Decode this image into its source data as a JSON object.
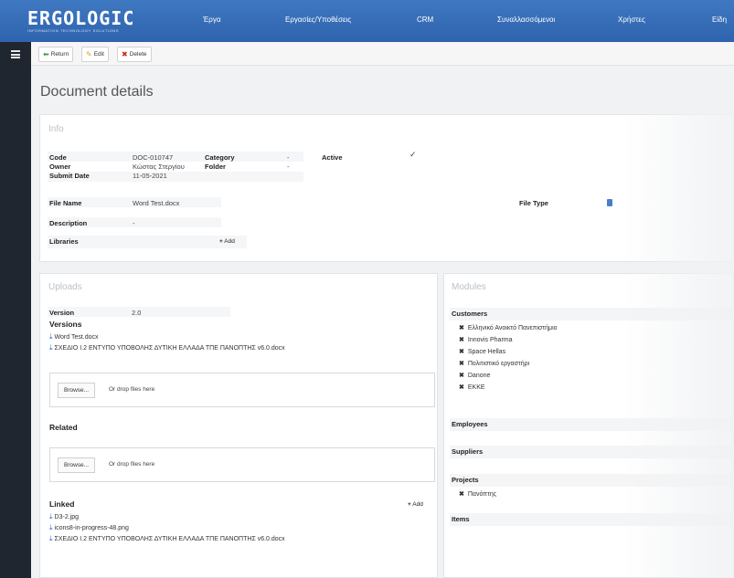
{
  "app": {
    "logo": "ERGOLOGIC",
    "logo_sub": "INFORMATION TECHNOLOGY SOLUTIONS",
    "nav": [
      "Έργα",
      "Εργασίες/Υποθέσεις",
      "CRM",
      "Συναλλασσόμενοι",
      "Χρήστες",
      "Είδη"
    ]
  },
  "toolbar": {
    "return_label": "Return",
    "edit_label": "Edit",
    "delete_label": "Delete"
  },
  "page_title": "Document details",
  "info": {
    "title": "Info",
    "code_label": "Code",
    "code_value": "DOC-010747",
    "owner_label": "Owner",
    "owner_value": "Κώστας Στεργίου",
    "submit_label": "Submit Date",
    "submit_value": "11-05-2021",
    "category_label": "Category",
    "category_value": "-",
    "folder_label": "Folder",
    "folder_value": "-",
    "active_label": "Active",
    "active_value": "✓",
    "filename_label": "File Name",
    "filename_value": "Word Test.docx",
    "filetype_label": "File Type",
    "description_label": "Description",
    "description_value": "-",
    "libraries_label": "Libraries",
    "add_label": "Add"
  },
  "uploads": {
    "title": "Uploads",
    "version_label": "Version",
    "version_value": "2.0",
    "versions_label": "Versions",
    "versions": [
      "Word Test.docx",
      "ΣΧΕΔΙΟ Ι.2 ΕΝΤΥΠΟ ΥΠΟΒΟΛΗΣ ΔΥΤΙΚΗ ΕΛΛΑΔΑ ΤΠΕ ΠΑΝΟΠΤΗΣ v6.0.docx"
    ],
    "browse_label": "Browse...",
    "drop_hint": "Or drop files here",
    "related_label": "Related",
    "linked_label": "Linked",
    "add_label": "Add",
    "linked": [
      "D3-2.jpg",
      "icons8-in-progress-48.png",
      "ΣΧΕΔΙΟ Ι.2 ΕΝΤΥΠΟ ΥΠΟΒΟΛΗΣ ΔΥΤΙΚΗ ΕΛΛΑΔΑ ΤΠΕ ΠΑΝΟΠΤΗΣ v6.0.docx"
    ]
  },
  "modules": {
    "title": "Modules",
    "customers_label": "Customers",
    "customers": [
      "Ελληνικό Ανοικτό Πανεπιστήμιο",
      "Innovis Pharma",
      "Space Hellas",
      "Πολιτιστικό εργαστήρι",
      "Danone",
      "ΕΚΚΕ"
    ],
    "employees_label": "Employees",
    "suppliers_label": "Suppliers",
    "projects_label": "Projects",
    "projects": [
      "Πανόπτης"
    ],
    "items_label": "Items"
  },
  "colors": {
    "topbar": "#2f63ad",
    "download_icon": "#2b6cc4",
    "delete_icon": "#cc2a1a",
    "edit_icon": "#e2a21a",
    "return_icon": "#3a9a3a"
  }
}
